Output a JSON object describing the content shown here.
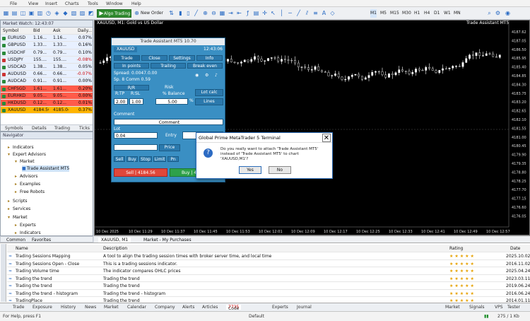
{
  "menu": [
    "File",
    "View",
    "Insert",
    "Charts",
    "Tools",
    "Window",
    "Help"
  ],
  "toolbar": {
    "algo_label": "Algo Trading",
    "neworder_label": "New Order",
    "timeframes": [
      "M1",
      "M5",
      "M15",
      "M30",
      "H1",
      "H4",
      "D1",
      "W1",
      "MN"
    ]
  },
  "market_watch": {
    "title": "Market Watch: 12:43:07",
    "headers": [
      "Symbol",
      "Bid",
      "Ask",
      "Daily..."
    ],
    "rows": [
      {
        "sym": "EURUSD",
        "bid": "1.16...",
        "ask": "1.16...",
        "chg": "0.07%",
        "color": "#e8f0ff",
        "chgcolor": "#000"
      },
      {
        "sym": "GBPUSD",
        "bid": "1.33...",
        "ask": "1.33...",
        "chg": "0.16%",
        "color": "#e8f0ff",
        "chgcolor": "#000"
      },
      {
        "sym": "USDCHF",
        "bid": "0.79...",
        "ask": "0.79...",
        "chg": "0.10%",
        "color": "#e8f0ff",
        "chgcolor": "#000"
      },
      {
        "sym": "USDJPY",
        "bid": "155....",
        "ask": "155....",
        "chg": "-0.08%",
        "color": "#e8f0ff",
        "chgcolor": "#c00"
      },
      {
        "sym": "USDCAD",
        "bid": "1.38...",
        "ask": "1.38...",
        "chg": "0.05%",
        "color": "#e8f0ff",
        "chgcolor": "#000"
      },
      {
        "sym": "AUDUSD",
        "bid": "0.66...",
        "ask": "0.66...",
        "chg": "-0.07%",
        "color": "#e8f0ff",
        "chgcolor": "#c00"
      },
      {
        "sym": "AUDCAD",
        "bid": "0.91...",
        "ask": "0.91...",
        "chg": "0.00%",
        "color": "#e8f0ff",
        "chgcolor": "#000"
      },
      {
        "sym": "CHFSGD",
        "bid": "1.61...",
        "ask": "1.61...",
        "chg": "0.20%",
        "color": "#ff5b4a",
        "chgcolor": "#000"
      },
      {
        "sym": "EURHKD",
        "bid": "9.05...",
        "ask": "9.05...",
        "chg": "0.00%",
        "color": "#ff5b4a",
        "chgcolor": "#000"
      },
      {
        "sym": "HKDUSD",
        "bid": "0.12...",
        "ask": "0.12...",
        "chg": "0.01%",
        "color": "#ff5b4a",
        "chgcolor": "#000"
      },
      {
        "sym": "XAUUSD",
        "bid": "4184.56",
        "ask": "4185.04",
        "chg": "0.37%",
        "color": "#ffb400",
        "chgcolor": "#000"
      }
    ],
    "tabs": [
      "Symbols",
      "Details",
      "Trading",
      "Ticks"
    ]
  },
  "navigator": {
    "title": "Navigator",
    "items": [
      "Indicators",
      "Expert Advisors",
      "Market",
      "Trade Assistant MT5",
      "Advisors",
      "Examples",
      "Free Robots",
      "Scripts",
      "Services",
      "Market",
      "Experts",
      "Indicators"
    ],
    "tabs": [
      "Common",
      "Favorites"
    ]
  },
  "chart": {
    "title": "XAUUSD, M1: Gold vs US Dollar",
    "ea_label": "Trade Assistant MT5",
    "prices": [
      "4187.62",
      "4187.05",
      "4186.50",
      "4185.95",
      "4185.40",
      "4184.85",
      "4184.30",
      "4183.75",
      "4183.20",
      "4182.65",
      "4182.10",
      "4181.55",
      "4181.00",
      "4180.45",
      "4179.90",
      "4179.35",
      "4178.80",
      "4178.25",
      "4177.70",
      "4177.15",
      "4176.60",
      "4176.05"
    ],
    "times": [
      "10 Dec 2025",
      "10 Dec 11:29",
      "10 Dec 11:37",
      "10 Dec 11:45",
      "10 Dec 11:53",
      "10 Dec 12:01",
      "10 Dec 12:09",
      "10 Dec 12:17",
      "10 Dec 12:25",
      "10 Dec 12:33",
      "10 Dec 12:41",
      "10 Dec 12:49",
      "10 Dec 12:57"
    ],
    "tabs": [
      "XAUUSD, M1"
    ]
  },
  "trade_assistant": {
    "header": "Trade Assistant MT5 10.70",
    "symbol": "XAUUSD",
    "time": "12:43:06",
    "tabs": [
      "Trade",
      "Close",
      "Settings",
      "Info"
    ],
    "subtabs": [
      "In points",
      "Trailing",
      "Break even"
    ],
    "spread": "Spread: 0.0047.0.00",
    "lot_info": "Sp. 8 Comm 0.59",
    "sl_label": "R/R",
    "risk_label": "Risk",
    "rr_hdr": [
      "R:TP",
      "R:SL",
      "% Balance"
    ],
    "sl_val": "2.00",
    "tp_val": "1.00",
    "bal_val": "5.00",
    "pct": "%",
    "lot_calc": "Lot calc",
    "lines_btn": "Lines",
    "comment_label": "Comment",
    "comment_btn": "Comment",
    "lot_label": "Lot",
    "lot_val": "0.04",
    "entry_label": "Entry",
    "price_label": "Price",
    "order_btns": [
      "Sell",
      "Buy",
      "Stop",
      "Limit",
      "Pn"
    ],
    "sell_btn": "Sell | 4184.56",
    "buy_btn": "Buy | 4185.04"
  },
  "dialog": {
    "title": "Global Prime MetaTrader 5 Terminal",
    "message": "Do you really want to attach 'Trade Assistant MT5' instead of 'Trade Assistant MT5' to chart 'XAUUSD,M1'?",
    "yes": "Yes",
    "no": "No"
  },
  "market_tab_title": "Market - My Purchases",
  "market": {
    "headers": [
      "Name",
      "Description",
      "Rating",
      "Date"
    ],
    "rows": [
      {
        "name": "Trading Sessions Mapping",
        "desc": "A tool to align the trading session times with broker server time, and local time",
        "stars": "★★★★★",
        "date": "2025.10.02"
      },
      {
        "name": "Trading Sessions Open - Close",
        "desc": "This is a trading sessions indicator.",
        "stars": "★★★★★",
        "date": "2016.11.02"
      },
      {
        "name": "Trading Volume time",
        "desc": "The indicator compares OHLC prices",
        "stars": "★★★★★",
        "date": "2025.04.24"
      },
      {
        "name": "Trading the trend",
        "desc": "Trading the trend",
        "stars": "★★★★★",
        "date": "2023.03.11"
      },
      {
        "name": "Trading the trend",
        "desc": "Trading the trend",
        "stars": "★★★★★",
        "date": "2019.06.24"
      },
      {
        "name": "Trading the trend - histogram",
        "desc": "Trading the trend - histogram",
        "stars": "★★★★★",
        "date": "2016.06.24"
      },
      {
        "name": "TradingPlace",
        "desc": "Trading the trend",
        "stars": "★★★★★",
        "date": "2014.01.11"
      }
    ]
  },
  "bottom_tabs": [
    "Trade",
    "Exposure",
    "History",
    "News",
    "Market",
    "Calendar",
    "Company",
    "Alerts",
    "Articles",
    "Code Base",
    "Experts",
    "Journal"
  ],
  "codebase_count": "7735",
  "status": {
    "help": "For Help, press F1",
    "profile": "Default",
    "market": "Market",
    "signals": "Signals",
    "vps": "VPS",
    "tester": "Tester",
    "traffic": "275 / 1 Kb"
  }
}
